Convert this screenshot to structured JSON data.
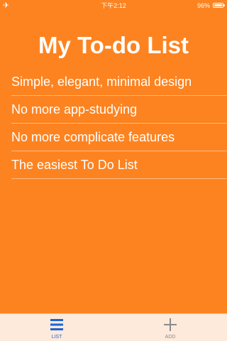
{
  "status_bar": {
    "airplane_icon": "airplane-icon",
    "time": "下午2:12",
    "battery_percent": "96%",
    "battery_level": 0.96
  },
  "title": "My To-do List",
  "items": [
    {
      "text": "Simple, elegant, minimal design"
    },
    {
      "text": "No more app-studying"
    },
    {
      "text": "No more complicate features"
    },
    {
      "text": "The easiest To Do List"
    }
  ],
  "tab_bar": {
    "tabs": [
      {
        "label": "LIST",
        "icon": "list-icon",
        "selected": true
      },
      {
        "label": "ADD",
        "icon": "plus-icon",
        "selected": false
      }
    ]
  },
  "colors": {
    "background": "#fd8320",
    "tab_bar": "#fdeadb",
    "accent": "#1c66d0",
    "inactive": "#8a8a8a"
  }
}
